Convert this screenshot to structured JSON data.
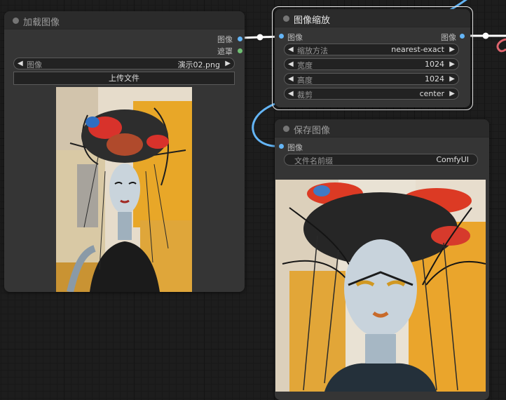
{
  "nodes": {
    "load_image": {
      "title": "加载图像",
      "outputs": [
        "图像",
        "遮罩"
      ],
      "image_widget": {
        "label": "图像",
        "value": "演示02.png"
      },
      "upload_button": "上传文件",
      "preview": "portrait-artwork-preview"
    },
    "image_scale": {
      "title": "图像缩放",
      "input_label": "图像",
      "output_label": "图像",
      "widgets": [
        {
          "label": "缩放方法",
          "value": "nearest-exact"
        },
        {
          "label": "宽度",
          "value": "1024"
        },
        {
          "label": "高度",
          "value": "1024"
        },
        {
          "label": "裁剪",
          "value": "center"
        }
      ]
    },
    "save_image": {
      "title": "保存图像",
      "input_label": "图像",
      "prefix_widget": {
        "label": "文件名前缀",
        "value": "ComfyUI"
      },
      "preview": "portrait-artwork-output"
    }
  },
  "colors": {
    "link_blue": "#64b5f6",
    "link_red": "#e0656e",
    "link_white": "#ffffff",
    "image_port": "#64b5f6",
    "mask_port": "#6fbf73"
  },
  "icons": [
    "arrow-left-icon",
    "arrow-right-icon",
    "node-status-dot"
  ]
}
